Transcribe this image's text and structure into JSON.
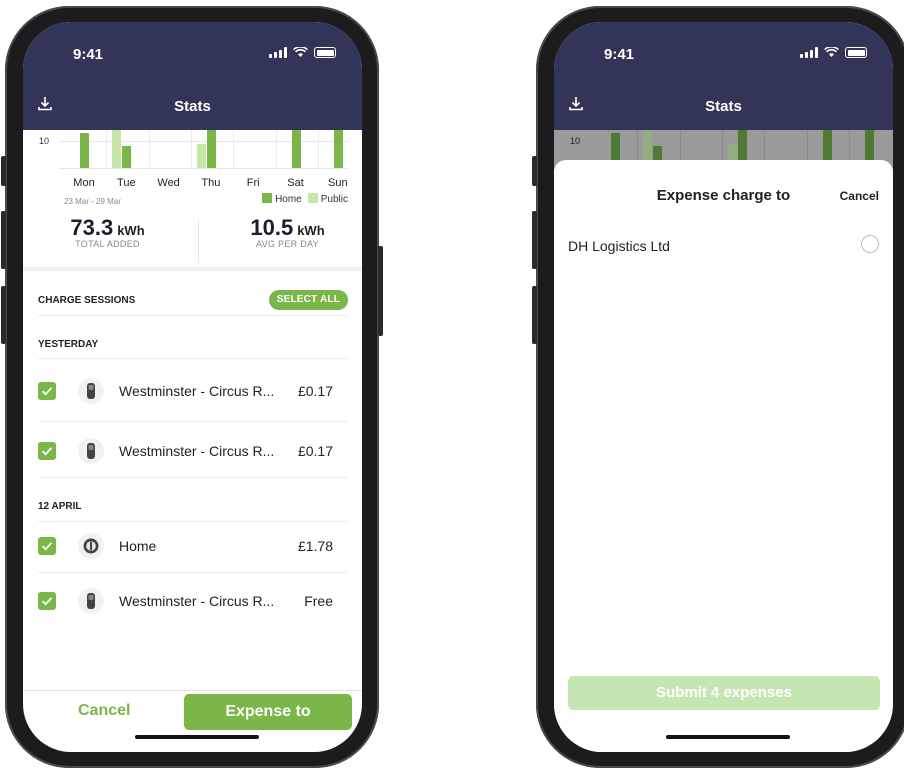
{
  "status_bar": {
    "time": "9:41"
  },
  "header": {
    "title": "Stats"
  },
  "chart_data": {
    "type": "bar",
    "categories": [
      "Mon",
      "Tue",
      "Wed",
      "Thu",
      "Fri",
      "Sat",
      "Sun"
    ],
    "series": [
      {
        "name": "Home",
        "values": [
          13,
          8,
          0,
          14,
          0,
          14,
          14
        ]
      },
      {
        "name": "Public",
        "values": [
          0,
          14,
          0,
          9,
          0,
          0,
          0
        ]
      }
    ],
    "y_tick_label": "10",
    "date_range": "23 Mar - 29 Mar",
    "colors": {
      "Home": "#7ab648",
      "Public": "#c5e6a8"
    }
  },
  "stats": {
    "total": {
      "value": "73.3",
      "unit": "kWh",
      "label": "TOTAL ADDED"
    },
    "average": {
      "value": "10.5",
      "unit": "kWh",
      "label": "AVG PER DAY"
    }
  },
  "sessions": {
    "heading": "CHARGE SESSIONS",
    "select_all": "SELECT ALL",
    "groups": [
      {
        "label": "YESTERDAY",
        "items": [
          {
            "name": "Westminster - Circus R...",
            "price": "£0.17",
            "icon": "public-charger-icon"
          },
          {
            "name": "Westminster - Circus R...",
            "price": "£0.17",
            "icon": "public-charger-icon"
          }
        ]
      },
      {
        "label": "12 APRIL",
        "items": [
          {
            "name": "Home",
            "price": "£1.78",
            "icon": "home-charger-icon"
          },
          {
            "name": "Westminster - Circus R...",
            "price": "Free",
            "icon": "public-charger-icon"
          }
        ]
      }
    ]
  },
  "footer": {
    "cancel": "Cancel",
    "expense": "Expense to"
  },
  "sheet": {
    "title": "Expense charge to",
    "cancel": "Cancel",
    "options": [
      {
        "label": "DH Logistics Ltd",
        "selected": false
      }
    ],
    "submit": "Submit 4 expenses"
  },
  "colors": {
    "brand_green": "#7ab648",
    "header_navy": "#333558"
  }
}
